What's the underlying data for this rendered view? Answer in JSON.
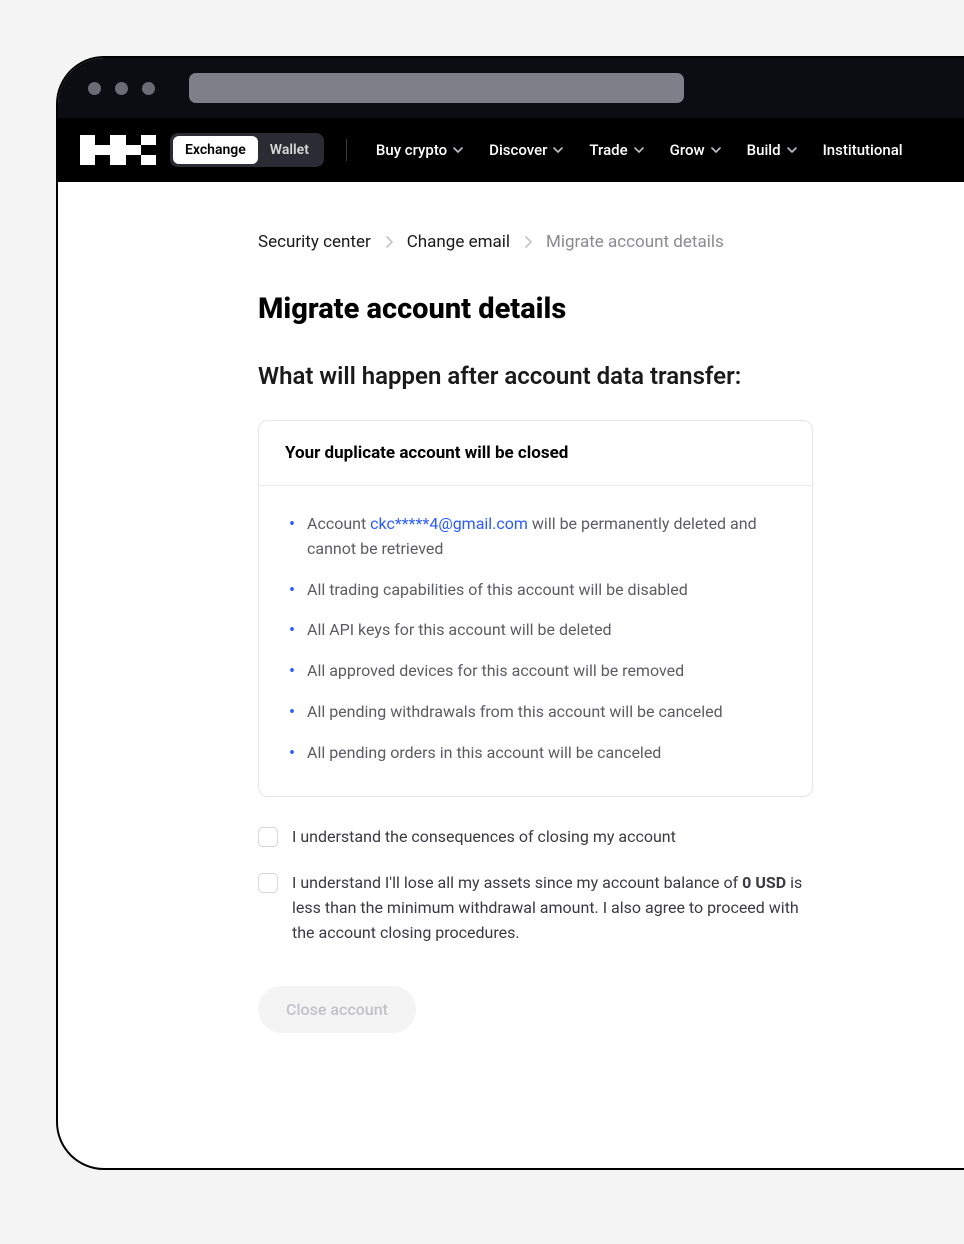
{
  "toggle": {
    "exchange": "Exchange",
    "wallet": "Wallet"
  },
  "nav": {
    "items": [
      {
        "label": "Buy crypto"
      },
      {
        "label": "Discover"
      },
      {
        "label": "Trade"
      },
      {
        "label": "Grow"
      },
      {
        "label": "Build"
      },
      {
        "label": "Institutional"
      }
    ]
  },
  "breadcrumb": {
    "a": "Security center",
    "b": "Change email",
    "c": "Migrate account details"
  },
  "page": {
    "title": "Migrate account details",
    "subtitle": "What will happen after account data transfer:"
  },
  "panel": {
    "heading": "Your duplicate account will be closed",
    "item0_prefix": "Account ",
    "item0_email": "ckc*****4@gmail.com",
    "item0_suffix": " will be permanently deleted and cannot be retrieved",
    "item1": "All trading capabilities of this account will be disabled",
    "item2": "All API keys for this account will be deleted",
    "item3": "All approved devices for this account will be removed",
    "item4": "All pending withdrawals from this account will be canceled",
    "item5": "All pending orders in this account will be canceled"
  },
  "checks": {
    "c1": "I understand the consequences of closing my account",
    "c2_a": "I understand I'll lose all my assets since my account balance of ",
    "c2_bold": "0 USD",
    "c2_b": " is less than the minimum withdrawal amount. I also agree to proceed with the account closing procedures."
  },
  "button": {
    "close": "Close account"
  }
}
